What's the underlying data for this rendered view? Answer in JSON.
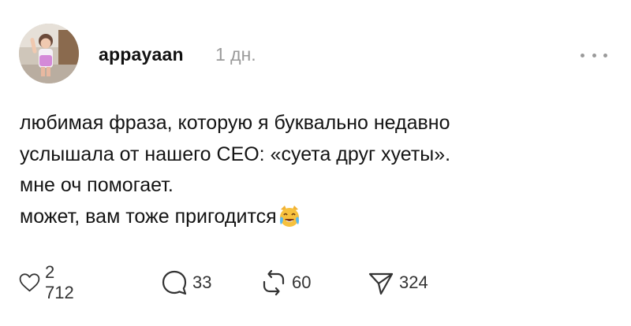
{
  "post": {
    "author": {
      "username": "appayaan",
      "avatar_icon": "avatar-photo"
    },
    "timestamp": "1 дн.",
    "menu_icon": "more-dots-icon",
    "text_lines": [
      "любимая фраза, которую я буквально недавно",
      "услышала от нашего CEO: «суета друг хуеты».",
      "мне оч помогает.",
      "может, вам тоже пригодится"
    ],
    "emoji": "cat-tears-of-joy-emoji",
    "actions": {
      "likes": {
        "icon": "heart-icon",
        "count": "2 712"
      },
      "replies": {
        "icon": "comment-icon",
        "count": "33"
      },
      "reposts": {
        "icon": "repost-icon",
        "count": "60"
      },
      "shares": {
        "icon": "send-icon",
        "count": "324"
      }
    }
  },
  "colors": {
    "text": "#141414",
    "muted": "#9a9a9a",
    "icon_stroke": "#333333",
    "background": "#ffffff"
  }
}
